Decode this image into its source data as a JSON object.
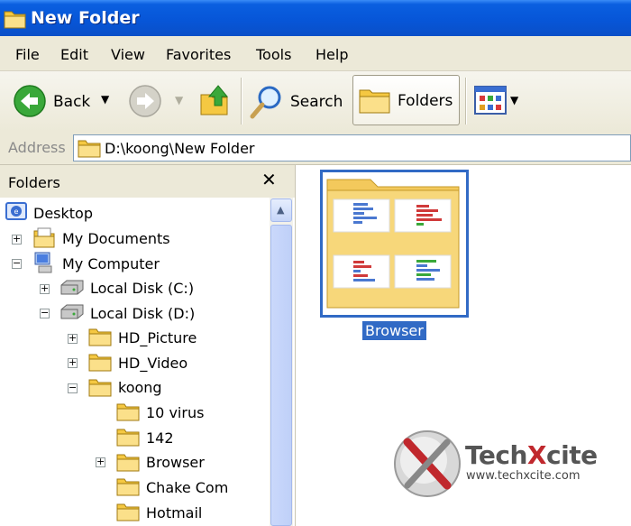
{
  "window": {
    "title": "New Folder",
    "icon": "folder-icon"
  },
  "menu": {
    "items": [
      "File",
      "Edit",
      "View",
      "Favorites",
      "Tools",
      "Help"
    ]
  },
  "toolbar": {
    "back_label": "Back",
    "search_label": "Search",
    "folders_label": "Folders",
    "icons": [
      "back-arrow-icon",
      "forward-arrow-icon",
      "up-folder-icon",
      "search-magnifier-icon",
      "folders-icon",
      "views-icon"
    ]
  },
  "address": {
    "label": "Address",
    "value": "D:\\koong\\New Folder"
  },
  "folders_pane": {
    "title": "Folders",
    "close_glyph": "✕",
    "tree": [
      {
        "label": "Desktop",
        "icon": "desktop-icon"
      },
      {
        "label": "My Documents",
        "icon": "my-documents-icon",
        "expander": "+"
      },
      {
        "label": "My Computer",
        "icon": "my-computer-icon",
        "expander": "−"
      },
      {
        "label": "Local Disk (C:)",
        "icon": "hard-disk-icon",
        "expander": "+"
      },
      {
        "label": "Local Disk (D:)",
        "icon": "hard-disk-icon",
        "expander": "−"
      },
      {
        "label": "HD_Picture",
        "icon": "folder-icon",
        "expander": "+"
      },
      {
        "label": "HD_Video",
        "icon": "folder-icon",
        "expander": "+"
      },
      {
        "label": "koong",
        "icon": "folder-icon",
        "expander": "−"
      },
      {
        "label": "10 virus",
        "icon": "folder-icon"
      },
      {
        "label": "142",
        "icon": "folder-icon"
      },
      {
        "label": "Browser",
        "icon": "folder-icon",
        "expander": "+"
      },
      {
        "label": "Chake Com",
        "icon": "folder-icon"
      },
      {
        "label": "Hotmail",
        "icon": "folder-icon"
      }
    ]
  },
  "content": {
    "items": [
      {
        "label": "Browser",
        "selected": true,
        "icon": "folder-thumbnail-icon"
      }
    ]
  },
  "watermark": {
    "brand_prefix": "Tech",
    "brand_x": "X",
    "brand_suffix": "cite",
    "url": "www.techxcite.com"
  },
  "colors": {
    "title_bar": "#0a5fe0",
    "selection": "#316ac5",
    "chrome": "#ece9d8",
    "folder_yellow": "#f5d46a"
  }
}
